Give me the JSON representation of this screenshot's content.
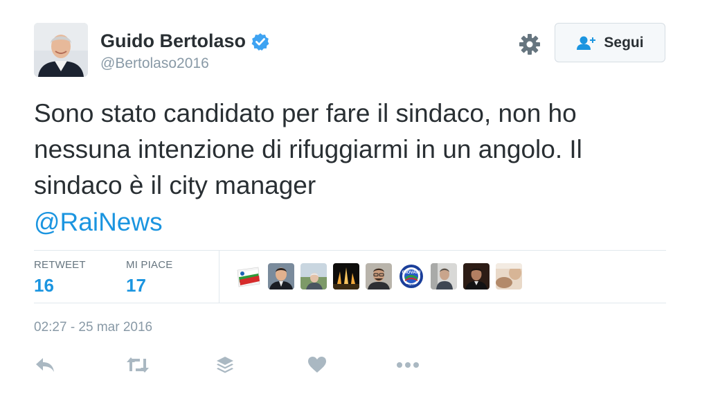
{
  "user": {
    "display_name": "Guido Bertolaso",
    "handle": "@Bertolaso2016",
    "verified": true
  },
  "follow_button": {
    "label": "Segui",
    "icon": "add-user-icon"
  },
  "tweet": {
    "text": "Sono stato candidato per fare il sindaco, non ho nessuna intenzione di rifuggiarmi in un angolo. Il sindaco è il city manager",
    "mention": "@RaiNews"
  },
  "stats": {
    "retweet_label": "RETWEET",
    "retweet_count": "16",
    "likes_label": "MI PIACE",
    "likes_count": "17"
  },
  "timestamp": "02:27 - 25 mar 2016",
  "liker_avatars": [
    {
      "name": "forza-italia-logo"
    },
    {
      "name": "man-suit-portrait"
    },
    {
      "name": "man-outdoor-portrait"
    },
    {
      "name": "night-fountain-photo"
    },
    {
      "name": "man-glasses-portrait"
    },
    {
      "name": "giovani-roma-logo",
      "text": "GIOVANI",
      "subtext": "ROMA"
    },
    {
      "name": "man-gray-portrait"
    },
    {
      "name": "man-dark-portrait"
    },
    {
      "name": "blurred-photo"
    }
  ],
  "actions": [
    "reply-icon",
    "retweet-icon",
    "stack-icon",
    "heart-icon",
    "more-icon"
  ],
  "colors": {
    "accent": "#1b95e0",
    "text": "#292f33",
    "muted": "#8899a6",
    "divider": "#e1e8ed",
    "icon_gray": "#aab8c2"
  }
}
